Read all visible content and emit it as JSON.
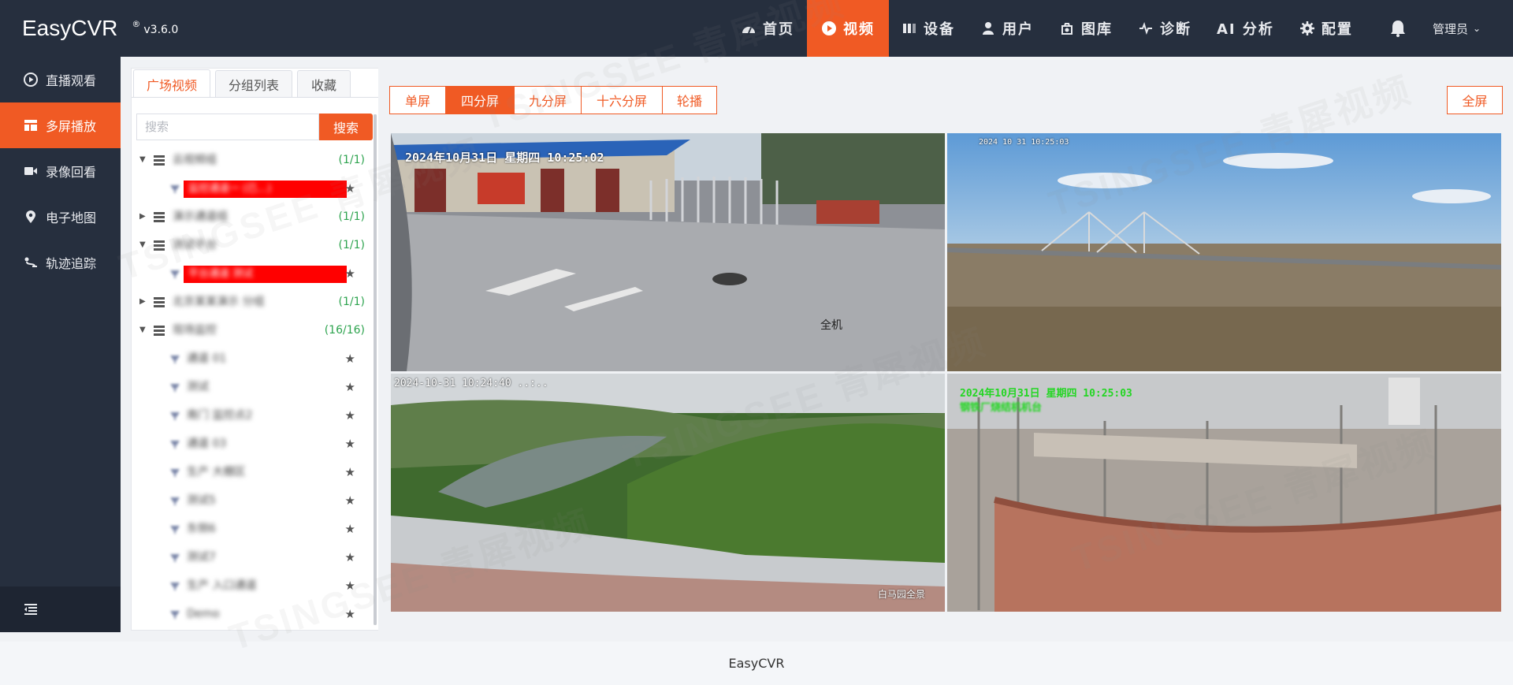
{
  "brand": {
    "name": "EasyCVR",
    "reg": "®",
    "version": "v3.6.0"
  },
  "nav": [
    {
      "label": "首页",
      "icon": "dashboard-icon"
    },
    {
      "label": "视频",
      "icon": "play-circle-icon",
      "active": true
    },
    {
      "label": "设备",
      "icon": "device-icon"
    },
    {
      "label": "用户",
      "icon": "user-icon"
    },
    {
      "label": "图库",
      "icon": "gallery-icon"
    },
    {
      "label": "诊断",
      "icon": "pulse-icon"
    },
    {
      "label": "AI 分析",
      "icon": ""
    },
    {
      "label": "配置",
      "icon": "gear-icon"
    }
  ],
  "header": {
    "user": "管理员"
  },
  "sidebar": {
    "items": [
      {
        "label": "直播观看",
        "icon": "play-circle-icon"
      },
      {
        "label": "多屏播放",
        "icon": "grid-icon",
        "active": true
      },
      {
        "label": "录像回看",
        "icon": "video-camera-icon"
      },
      {
        "label": "电子地图",
        "icon": "map-pin-icon"
      },
      {
        "label": "轨迹追踪",
        "icon": "track-icon"
      }
    ]
  },
  "panel": {
    "tabs": [
      "广场视频",
      "分组列表",
      "收藏"
    ],
    "search_placeholder": "搜索",
    "search_button": "搜索",
    "tree": [
      {
        "type": "group",
        "expanded": true,
        "label": "云视频组",
        "count": "(1/1)"
      },
      {
        "type": "channel",
        "label": "监控通道一 (已…)",
        "redacted": true
      },
      {
        "type": "group",
        "expanded": false,
        "label": "演示通道组",
        "count": "(1/1)"
      },
      {
        "type": "group",
        "expanded": true,
        "label": "测试平台",
        "count": "(1/1)"
      },
      {
        "type": "channel",
        "label": "平台通道 测试",
        "redacted": true
      },
      {
        "type": "group",
        "expanded": false,
        "label": "北京某某演示 分组",
        "count": "(1/1)"
      },
      {
        "type": "group",
        "expanded": true,
        "label": "现场监控",
        "count": "(16/16)"
      },
      {
        "type": "channel",
        "label": "通道 01"
      },
      {
        "type": "channel",
        "label": "测试"
      },
      {
        "type": "channel",
        "label": "南门 监控点2"
      },
      {
        "type": "channel",
        "label": "通道 03"
      },
      {
        "type": "channel",
        "label": "生产 大棚区"
      },
      {
        "type": "channel",
        "label": "测试5"
      },
      {
        "type": "channel",
        "label": "东侧6"
      },
      {
        "type": "channel",
        "label": "测试7"
      },
      {
        "type": "channel",
        "label": "生产 入口通道"
      },
      {
        "type": "channel",
        "label": "Demo"
      }
    ]
  },
  "layout_buttons": [
    "单屏",
    "四分屏",
    "九分屏",
    "十六分屏",
    "轮播"
  ],
  "layout_active": 1,
  "fullscreen_label": "全屏",
  "videos": [
    {
      "osd": "2024年10月31日  星期四  10:25:02",
      "caption": "全机"
    },
    {
      "osd": "2024 10 31 10:25:03",
      "caption": ""
    },
    {
      "osd": "2024-10-31 10:24:40 ..:..",
      "caption": "白马园全景"
    },
    {
      "osd": "2024年10月31日 星期四 10:25:03",
      "osd2": "钢铁厂烧结机机台",
      "caption": ""
    }
  ],
  "footer": "EasyCVR",
  "watermark": "TSINGSEE 青犀视频",
  "colors": {
    "accent": "#f05a24",
    "header_bg": "#262f3e",
    "count_green": "#2ea44f"
  }
}
